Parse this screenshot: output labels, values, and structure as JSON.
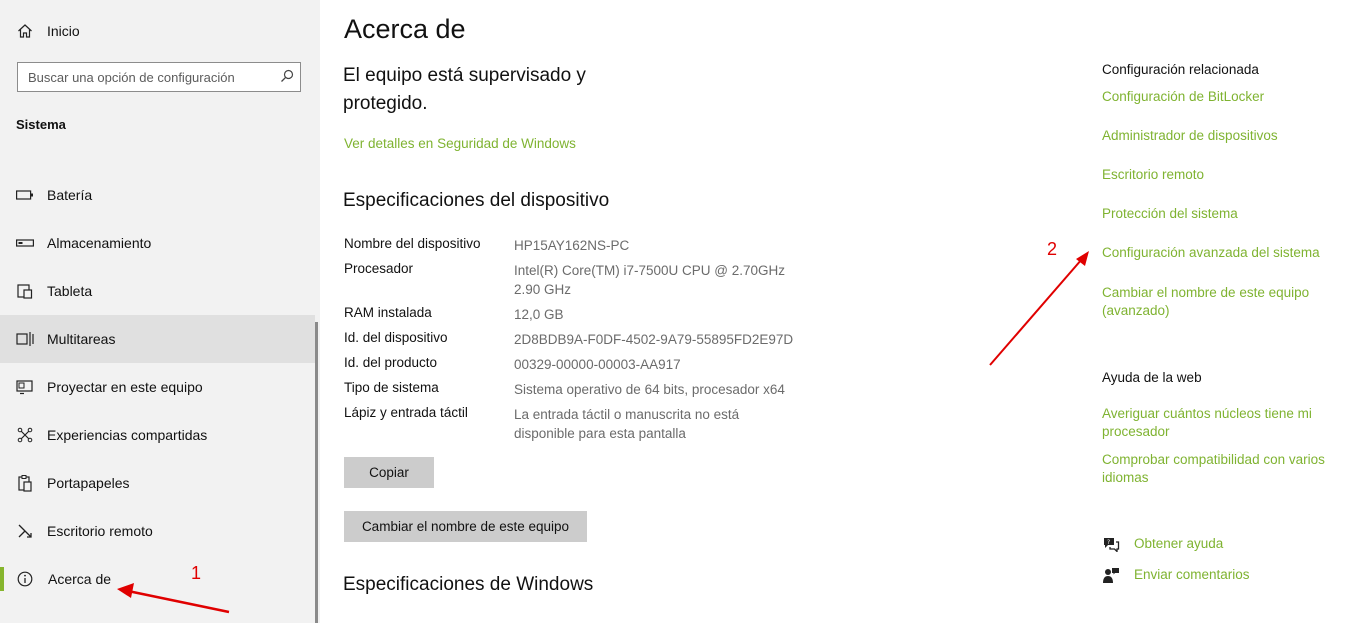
{
  "sidebar": {
    "home_label": "Inicio",
    "search_placeholder": "Buscar una opción de configuración",
    "section_label": "Sistema",
    "items": [
      {
        "label": "Batería",
        "icon": "battery-icon"
      },
      {
        "label": "Almacenamiento",
        "icon": "storage-icon"
      },
      {
        "label": "Tableta",
        "icon": "tablet-icon"
      },
      {
        "label": "Multitareas",
        "icon": "multitasking-icon"
      },
      {
        "label": "Proyectar en este equipo",
        "icon": "project-icon"
      },
      {
        "label": "Experiencias compartidas",
        "icon": "shared-experiences-icon"
      },
      {
        "label": "Portapapeles",
        "icon": "clipboard-icon"
      },
      {
        "label": "Escritorio remoto",
        "icon": "remote-desktop-icon"
      },
      {
        "label": "Acerca de",
        "icon": "info-icon"
      }
    ]
  },
  "main": {
    "title": "Acerca de",
    "protection_text": "El equipo está supervisado y protegido.",
    "security_link": "Ver detalles en Seguridad de Windows",
    "device_specs_heading": "Especificaciones del dispositivo",
    "specs": [
      {
        "key": "Nombre del dispositivo",
        "value": "HP15AY162NS-PC"
      },
      {
        "key": "Procesador",
        "value": "Intel(R) Core(TM) i7-7500U CPU @ 2.70GHz 2.90 GHz"
      },
      {
        "key": "RAM instalada",
        "value": "12,0 GB"
      },
      {
        "key": "Id. del dispositivo",
        "value": "2D8BDB9A-F0DF-4502-9A79-55895FD2E97D"
      },
      {
        "key": "Id. del producto",
        "value": "00329-00000-00003-AA917"
      },
      {
        "key": "Tipo de sistema",
        "value": "Sistema operativo de 64 bits, procesador x64"
      },
      {
        "key": "Lápiz y entrada táctil",
        "value": "La entrada táctil o manuscrita no está disponible para esta pantalla"
      }
    ],
    "copy_button": "Copiar",
    "rename_button": "Cambiar el nombre de este equipo",
    "windows_specs_heading": "Especificaciones de Windows"
  },
  "related": {
    "title": "Configuración relacionada",
    "links": [
      "Configuración de BitLocker",
      "Administrador de dispositivos",
      "Escritorio remoto",
      "Protección del sistema",
      "Configuración avanzada del sistema",
      "Cambiar el nombre de este equipo (avanzado)"
    ],
    "web_help_title": "Ayuda de la web",
    "web_links": [
      "Averiguar cuántos núcleos tiene mi procesador",
      "Comprobar compatibilidad con varios idiomas"
    ],
    "get_help": "Obtener ayuda",
    "feedback": "Enviar comentarios"
  },
  "annotations": {
    "marker_1": "1",
    "marker_2": "2"
  },
  "colors": {
    "accent": "#7fb331",
    "annotation": "#e00000"
  }
}
